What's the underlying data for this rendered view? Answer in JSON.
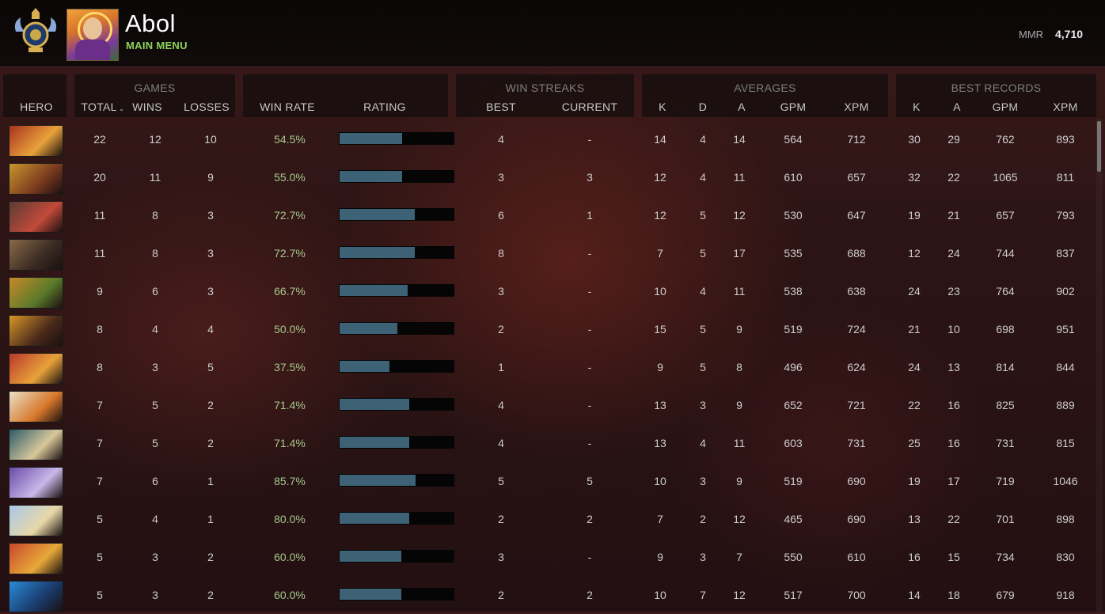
{
  "player": {
    "name": "Abol",
    "menu_link": "MAIN MENU",
    "mmr_label": "MMR",
    "mmr_value": "4,710"
  },
  "groups": {
    "games": "GAMES",
    "win_streaks": "WIN STREAKS",
    "averages": "AVERAGES",
    "best_records": "BEST RECORDS"
  },
  "columns": {
    "hero": "HERO",
    "total": "TOTAL",
    "wins": "WINS",
    "losses": "LOSSES",
    "win_rate": "WIN RATE",
    "rating": "RATING",
    "best": "BEST",
    "current": "CURRENT",
    "avg_k": "K",
    "avg_d": "D",
    "avg_a": "A",
    "avg_gpm": "GPM",
    "avg_xpm": "XPM",
    "best_k": "K",
    "best_a": "A",
    "best_gpm": "GPM",
    "best_xpm": "XPM"
  },
  "colors": {
    "accent_green": "#8fd35c",
    "bar_fill": "#3e6275"
  },
  "rows": [
    {
      "hero_icon": "dragon-knight-portrait",
      "hero_colors": [
        "#a8321e",
        "#e8a23a"
      ],
      "total": "22",
      "wins": "12",
      "losses": "10",
      "win_rate": "54.5%",
      "rating": 0.55,
      "best": "4",
      "current": "-",
      "k": "14",
      "d": "4",
      "a": "14",
      "gpm": "564",
      "xpm": "712",
      "bk": "30",
      "ba": "29",
      "bgpm": "762",
      "bxpm": "893"
    },
    {
      "hero_icon": "bounty-hunter-portrait",
      "hero_colors": [
        "#c9962e",
        "#7a3a1e"
      ],
      "total": "20",
      "wins": "11",
      "losses": "9",
      "win_rate": "55.0%",
      "rating": 0.55,
      "best": "3",
      "current": "3",
      "k": "12",
      "d": "4",
      "a": "11",
      "gpm": "610",
      "xpm": "657",
      "bk": "32",
      "ba": "22",
      "bgpm": "1065",
      "bxpm": "811"
    },
    {
      "hero_icon": "axe-portrait",
      "hero_colors": [
        "#5a3a34",
        "#c24a3a"
      ],
      "total": "11",
      "wins": "8",
      "losses": "3",
      "win_rate": "72.7%",
      "rating": 0.66,
      "best": "6",
      "current": "1",
      "k": "12",
      "d": "5",
      "a": "12",
      "gpm": "530",
      "xpm": "647",
      "bk": "19",
      "ba": "21",
      "bgpm": "657",
      "bxpm": "793"
    },
    {
      "hero_icon": "beastmaster-portrait",
      "hero_colors": [
        "#8a6a4a",
        "#3a2a22"
      ],
      "total": "11",
      "wins": "8",
      "losses": "3",
      "win_rate": "72.7%",
      "rating": 0.66,
      "best": "8",
      "current": "-",
      "k": "7",
      "d": "5",
      "a": "17",
      "gpm": "535",
      "xpm": "688",
      "bk": "12",
      "ba": "24",
      "bgpm": "744",
      "bxpm": "837"
    },
    {
      "hero_icon": "monkey-king-portrait",
      "hero_colors": [
        "#c88a2a",
        "#5a7a2a"
      ],
      "total": "9",
      "wins": "6",
      "losses": "3",
      "win_rate": "66.7%",
      "rating": 0.6,
      "best": "3",
      "current": "-",
      "k": "10",
      "d": "4",
      "a": "11",
      "gpm": "538",
      "xpm": "638",
      "bk": "24",
      "ba": "23",
      "bgpm": "764",
      "bxpm": "902"
    },
    {
      "hero_icon": "sand-king-portrait",
      "hero_colors": [
        "#d8962a",
        "#4a2a1a"
      ],
      "total": "8",
      "wins": "4",
      "losses": "4",
      "win_rate": "50.0%",
      "rating": 0.51,
      "best": "2",
      "current": "-",
      "k": "15",
      "d": "5",
      "a": "9",
      "gpm": "519",
      "xpm": "724",
      "bk": "21",
      "ba": "10",
      "bgpm": "698",
      "bxpm": "951"
    },
    {
      "hero_icon": "legion-commander-portrait",
      "hero_colors": [
        "#b8382a",
        "#e8a23a"
      ],
      "total": "8",
      "wins": "3",
      "losses": "5",
      "win_rate": "37.5%",
      "rating": 0.44,
      "best": "1",
      "current": "-",
      "k": "9",
      "d": "5",
      "a": "8",
      "gpm": "496",
      "xpm": "624",
      "bk": "24",
      "ba": "13",
      "bgpm": "814",
      "bxpm": "844"
    },
    {
      "hero_icon": "mars-portrait",
      "hero_colors": [
        "#e8e0c8",
        "#d8782a"
      ],
      "total": "7",
      "wins": "5",
      "losses": "2",
      "win_rate": "71.4%",
      "rating": 0.61,
      "best": "4",
      "current": "-",
      "k": "13",
      "d": "3",
      "a": "9",
      "gpm": "652",
      "xpm": "721",
      "bk": "22",
      "ba": "16",
      "bgpm": "825",
      "bxpm": "889"
    },
    {
      "hero_icon": "slardar-portrait",
      "hero_colors": [
        "#2a5a6a",
        "#d8c89a"
      ],
      "total": "7",
      "wins": "5",
      "losses": "2",
      "win_rate": "71.4%",
      "rating": 0.61,
      "best": "4",
      "current": "-",
      "k": "13",
      "d": "4",
      "a": "11",
      "gpm": "603",
      "xpm": "731",
      "bk": "25",
      "ba": "16",
      "bgpm": "731",
      "bxpm": "815"
    },
    {
      "hero_icon": "faceless-void-portrait",
      "hero_colors": [
        "#6a4aa8",
        "#c8b8e8"
      ],
      "total": "7",
      "wins": "6",
      "losses": "1",
      "win_rate": "85.7%",
      "rating": 0.67,
      "best": "5",
      "current": "5",
      "k": "10",
      "d": "3",
      "a": "9",
      "gpm": "519",
      "xpm": "690",
      "bk": "19",
      "ba": "17",
      "bgpm": "719",
      "bxpm": "1046"
    },
    {
      "hero_icon": "crystal-maiden-portrait",
      "hero_colors": [
        "#a8c8e8",
        "#e8d8a8"
      ],
      "total": "5",
      "wins": "4",
      "losses": "1",
      "win_rate": "80.0%",
      "rating": 0.61,
      "best": "2",
      "current": "2",
      "k": "7",
      "d": "2",
      "a": "12",
      "gpm": "465",
      "xpm": "690",
      "bk": "13",
      "ba": "22",
      "bgpm": "701",
      "bxpm": "898"
    },
    {
      "hero_icon": "ember-spirit-portrait",
      "hero_colors": [
        "#c8482a",
        "#e8a83a"
      ],
      "total": "5",
      "wins": "3",
      "losses": "2",
      "win_rate": "60.0%",
      "rating": 0.54,
      "best": "3",
      "current": "-",
      "k": "9",
      "d": "3",
      "a": "7",
      "gpm": "550",
      "xpm": "610",
      "bk": "16",
      "ba": "15",
      "bgpm": "734",
      "bxpm": "830"
    },
    {
      "hero_icon": "morphling-portrait",
      "hero_colors": [
        "#2a8ad8",
        "#1a3a6a"
      ],
      "total": "5",
      "wins": "3",
      "losses": "2",
      "win_rate": "60.0%",
      "rating": 0.54,
      "best": "2",
      "current": "2",
      "k": "10",
      "d": "7",
      "a": "12",
      "gpm": "517",
      "xpm": "700",
      "bk": "14",
      "ba": "18",
      "bgpm": "679",
      "bxpm": "918"
    }
  ]
}
